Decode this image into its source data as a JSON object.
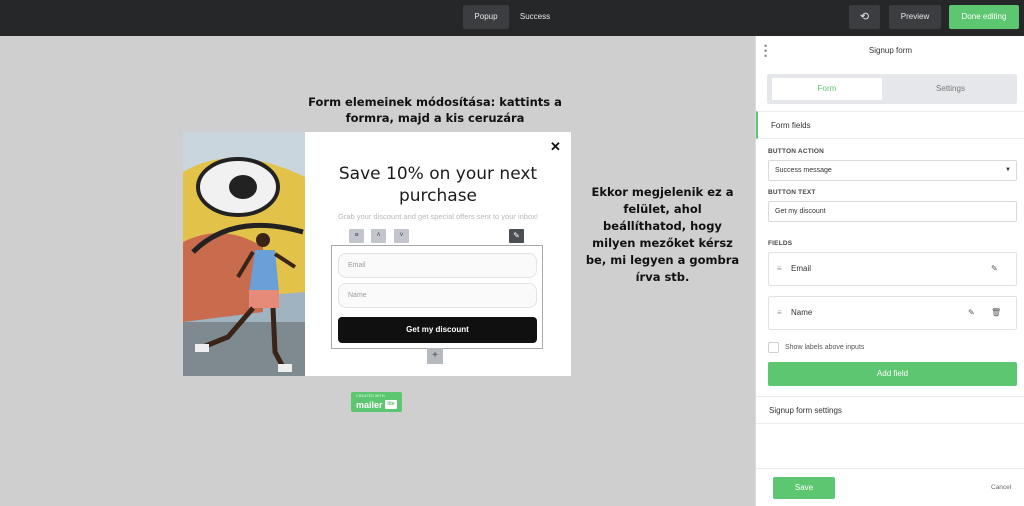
{
  "topbar": {
    "tabs": [
      "Popup",
      "Success"
    ],
    "undo_icon": "undo-icon",
    "preview_label": "Preview",
    "done_label": "Done editing"
  },
  "canvas": {
    "annotation_1": "Form elemeinek módosítása: kattints a formra, majd a kis ceruzára",
    "annotation_2": "Ekkor megjelenik ez a felület, ahol beállíthatod, hogy milyen mezőket kérsz be, mi legyen a gombra írva stb.",
    "popup": {
      "close_icon": "close-icon",
      "heading": "Save 10% on your next purchase",
      "subtitle": "Grab your discount and get special offers sent to your inbox!",
      "email_placeholder": "Email",
      "name_placeholder": "Name",
      "button_label": "Get my discount"
    },
    "badge": {
      "small": "CREATED WITH",
      "big": "mailer",
      "lite": "lite"
    }
  },
  "panel": {
    "title": "Signup form",
    "tabs": [
      "Form",
      "Settings"
    ],
    "form_fields_label": "Form fields",
    "button_action_label": "BUTTON ACTION",
    "button_action_value": "Success message",
    "button_text_label": "BUTTON TEXT",
    "button_text_value": "Get my discount",
    "fields_label": "FIELDS",
    "fields": [
      "Email",
      "Name"
    ],
    "show_labels": "Show labels above inputs",
    "add_field": "Add field",
    "signup_settings": "Signup form settings",
    "save": "Save",
    "cancel": "Cancel"
  },
  "colors": {
    "accent": "#5cc770",
    "topbar": "#262729",
    "canvas": "#cfcfcf"
  }
}
